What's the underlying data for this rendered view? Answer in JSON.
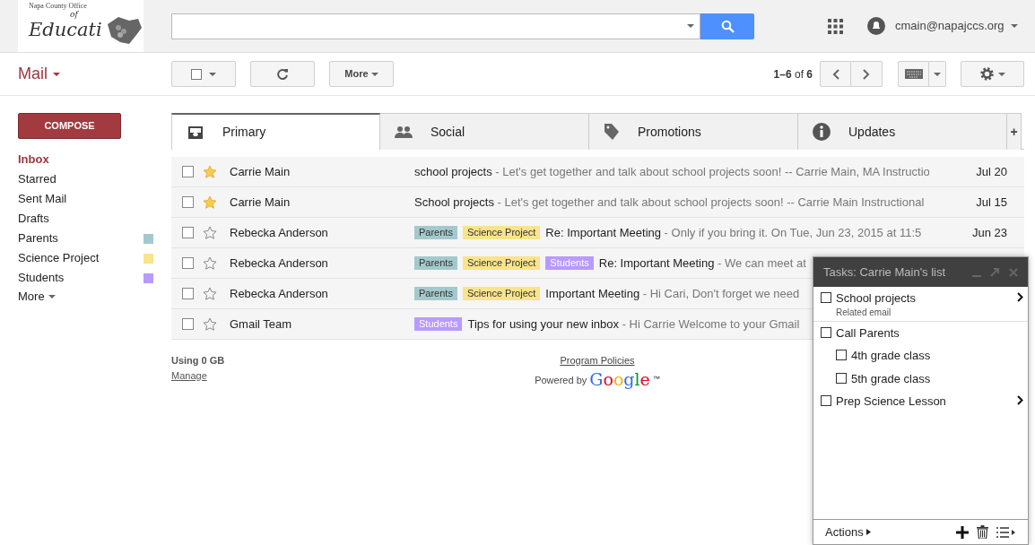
{
  "logo": {
    "top_line": "Napa County Office",
    "of": "of",
    "script": "Educati"
  },
  "account": {
    "email": "cmain@napajccs.org"
  },
  "app_title": "Mail",
  "toolbar": {
    "more": "More",
    "range": "1–6",
    "of": "of",
    "total": "6"
  },
  "compose": "COMPOSE",
  "sidebar": {
    "items": [
      {
        "label": "Inbox",
        "selected": true
      },
      {
        "label": "Starred",
        "selected": false
      },
      {
        "label": "Sent Mail",
        "selected": false
      },
      {
        "label": "Drafts",
        "selected": false
      },
      {
        "label": "Parents",
        "selected": false,
        "color": "#a4c9cd"
      },
      {
        "label": "Science Project",
        "selected": false,
        "color": "#f9e48a"
      },
      {
        "label": "Students",
        "selected": false,
        "color": "#b99aff"
      }
    ],
    "more": "More"
  },
  "tabs": [
    {
      "label": "Primary",
      "selected": true
    },
    {
      "label": "Social",
      "selected": false
    },
    {
      "label": "Promotions",
      "selected": false
    },
    {
      "label": "Updates",
      "selected": false
    }
  ],
  "add_tab": "+",
  "emails": [
    {
      "sender": "Carrie Main",
      "starred": true,
      "checked": false,
      "subject": "school projects",
      "snippet": " - Let's get together and talk about school projects soon! -- Carrie Main, MA Instructio",
      "date": "Jul 20"
    },
    {
      "sender": "Carrie Main",
      "starred": true,
      "checked": false,
      "subject": "School projects",
      "snippet": " - Let's get together and talk about school projects soon! -- Carrie Main Instructional",
      "date": "Jul 15"
    },
    {
      "sender": "Rebecka Anderson",
      "starred": false,
      "checked": false,
      "labels": [
        {
          "text": "Parents",
          "color": "#a4c9cd"
        },
        {
          "text": "Science Project",
          "color": "#f9e48a"
        }
      ],
      "subject": "Re: Important Meeting",
      "snippet": " - Only if you bring it. On Tue, Jun 23, 2015 at 11:5",
      "date": "Jun 23"
    },
    {
      "sender": "Rebecka Anderson",
      "starred": false,
      "checked": false,
      "labels": [
        {
          "text": "Parents",
          "color": "#a4c9cd"
        },
        {
          "text": "Science Project",
          "color": "#f9e48a"
        },
        {
          "text": "Students",
          "color": "#b99aff"
        }
      ],
      "subject": "Re: Important Meeting",
      "snippet": " - We can meet at"
    },
    {
      "sender": "Rebecka Anderson",
      "starred": false,
      "checked": false,
      "labels": [
        {
          "text": "Parents",
          "color": "#a4c9cd"
        },
        {
          "text": "Science Project",
          "color": "#f9e48a"
        }
      ],
      "subject": "Important Meeting",
      "snippet": " - Hi Cari, Don't forget we need"
    },
    {
      "sender": "Gmail Team",
      "starred": false,
      "checked": false,
      "labels": [
        {
          "text": "Students",
          "color": "#b99aff"
        }
      ],
      "subject": "Tips for using your new inbox",
      "snippet": " - Hi Carrie Welcome to your Gmail"
    }
  ],
  "footer": {
    "usage": "Using 0 GB",
    "manage": "Manage",
    "policies": "Program Policies",
    "powered_by": "Powered by",
    "google": "Google",
    "tm": "™"
  },
  "tasks": {
    "title": "Tasks: Carrie Main's list",
    "items": [
      {
        "title": "School projects",
        "note": "Related email",
        "checked": false,
        "has_details": true
      },
      {
        "title": "Call Parents",
        "checked": false,
        "has_details": false,
        "children": [
          {
            "title": "4th grade class",
            "checked": false,
            "has_details": false
          },
          {
            "title": "5th grade class",
            "checked": false,
            "has_details": false
          }
        ]
      },
      {
        "title": "Prep Science Lesson",
        "checked": false,
        "has_details": true
      }
    ],
    "actions": "Actions"
  }
}
